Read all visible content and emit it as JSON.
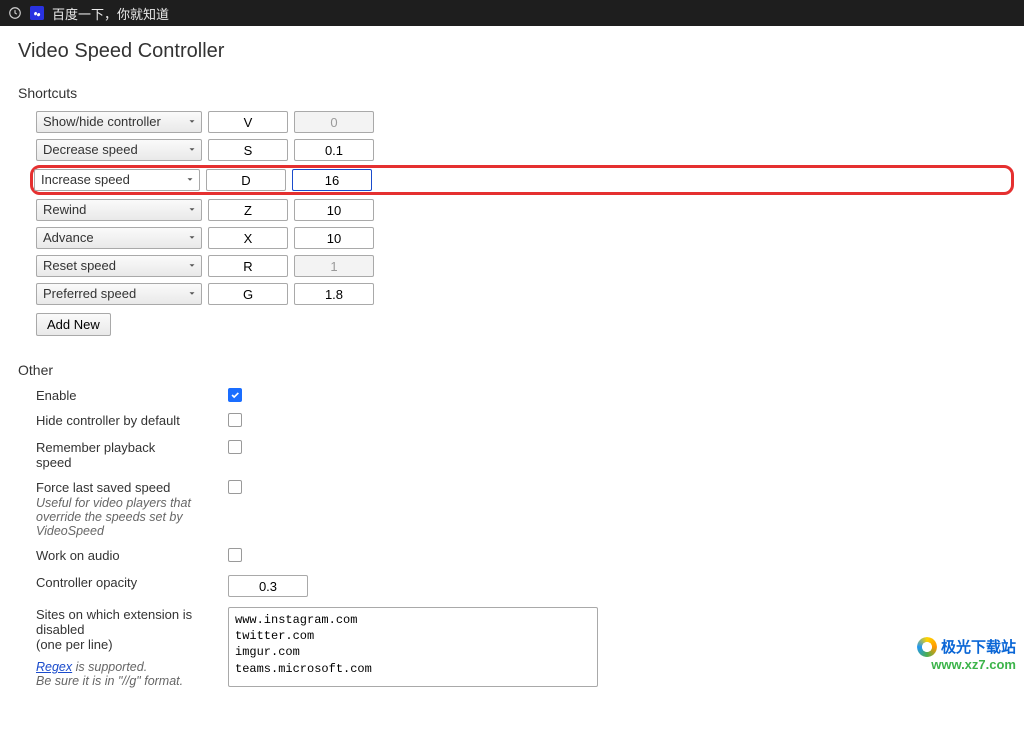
{
  "browser_tab": {
    "title": "百度一下，你就知道"
  },
  "page": {
    "title": "Video Speed Controller"
  },
  "shortcuts": {
    "section_title": "Shortcuts",
    "rows": [
      {
        "action": "Show/hide controller",
        "key": "V",
        "value": "0",
        "value_disabled": true,
        "highlight": false
      },
      {
        "action": "Decrease speed",
        "key": "S",
        "value": "0.1",
        "value_disabled": false,
        "highlight": false
      },
      {
        "action": "Increase speed",
        "key": "D",
        "value": "16",
        "value_disabled": false,
        "highlight": true
      },
      {
        "action": "Rewind",
        "key": "Z",
        "value": "10",
        "value_disabled": false,
        "highlight": false
      },
      {
        "action": "Advance",
        "key": "X",
        "value": "10",
        "value_disabled": false,
        "highlight": false
      },
      {
        "action": "Reset speed",
        "key": "R",
        "value": "1",
        "value_disabled": true,
        "highlight": false
      },
      {
        "action": "Preferred speed",
        "key": "G",
        "value": "1.8",
        "value_disabled": false,
        "highlight": false
      }
    ],
    "add_new_label": "Add New"
  },
  "other": {
    "section_title": "Other",
    "enable": {
      "label": "Enable",
      "checked": true
    },
    "hide_default": {
      "label": "Hide controller by default",
      "checked": false
    },
    "remember_speed": {
      "label": "Remember playback speed",
      "checked": false
    },
    "force_saved": {
      "label": "Force last saved speed",
      "hint": "Useful for video players that override the speeds set by VideoSpeed",
      "checked": false
    },
    "work_on_audio": {
      "label": "Work on audio",
      "checked": false
    },
    "controller_opacity": {
      "label": "Controller opacity",
      "value": "0.3"
    },
    "blacklist": {
      "label": "Sites on which extension is disabled",
      "hint1": "(one per line)",
      "regex_link_text": "Regex",
      "regex_rest": " is supported.",
      "regex_hint2": "Be sure it is in \"//g\" format.",
      "value": "www.instagram.com\ntwitter.com\nimgur.com\nteams.microsoft.com"
    }
  },
  "watermark": {
    "top": "极光下载站",
    "bottom": "www.xz7.com"
  }
}
